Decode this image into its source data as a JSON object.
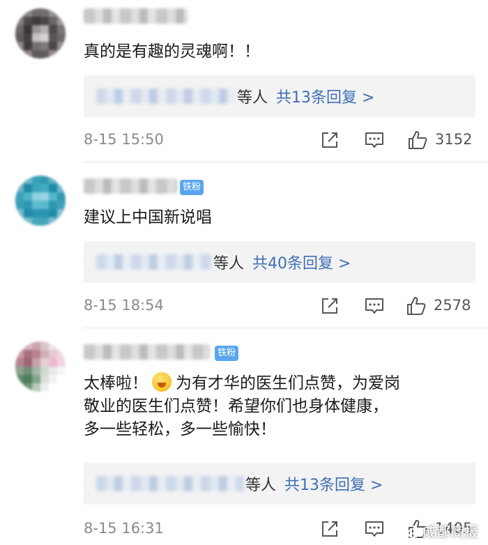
{
  "comments": [
    {
      "text": "真的是有趣的灵魂啊！！",
      "badge": "",
      "replies_etc": "等人",
      "replies_link": "共13条回复 >",
      "time": "8-15 15:50",
      "likes": "3152"
    },
    {
      "text": "建议上中国新说唱",
      "badge": "铁粉",
      "replies_etc": "等人",
      "replies_link": "共40条回复 >",
      "time": "8-15 18:54",
      "likes": "2578"
    },
    {
      "text_before_emoji": "太棒啦！",
      "text_after_emoji": "为有才华的医生们点赞，为爱岗\n敬业的医生们点赞！希望你们也身体健康，\n多一些轻松，多一些愉快！",
      "emoji_icon": "smiling-face-emoji",
      "badge": "铁粉",
      "replies_etc": "等人",
      "replies_link": "共13条回复 >",
      "time": "8-15 16:31",
      "likes": "1405"
    }
  ],
  "watermark": "成都商报",
  "icons": [
    "share-icon",
    "comment-icon",
    "like-icon"
  ],
  "colors": {
    "link": "#3f6fb5",
    "badge": "#5aa6ee",
    "reply_box": "#f3f3f3",
    "meta": "#8a8a8a"
  }
}
